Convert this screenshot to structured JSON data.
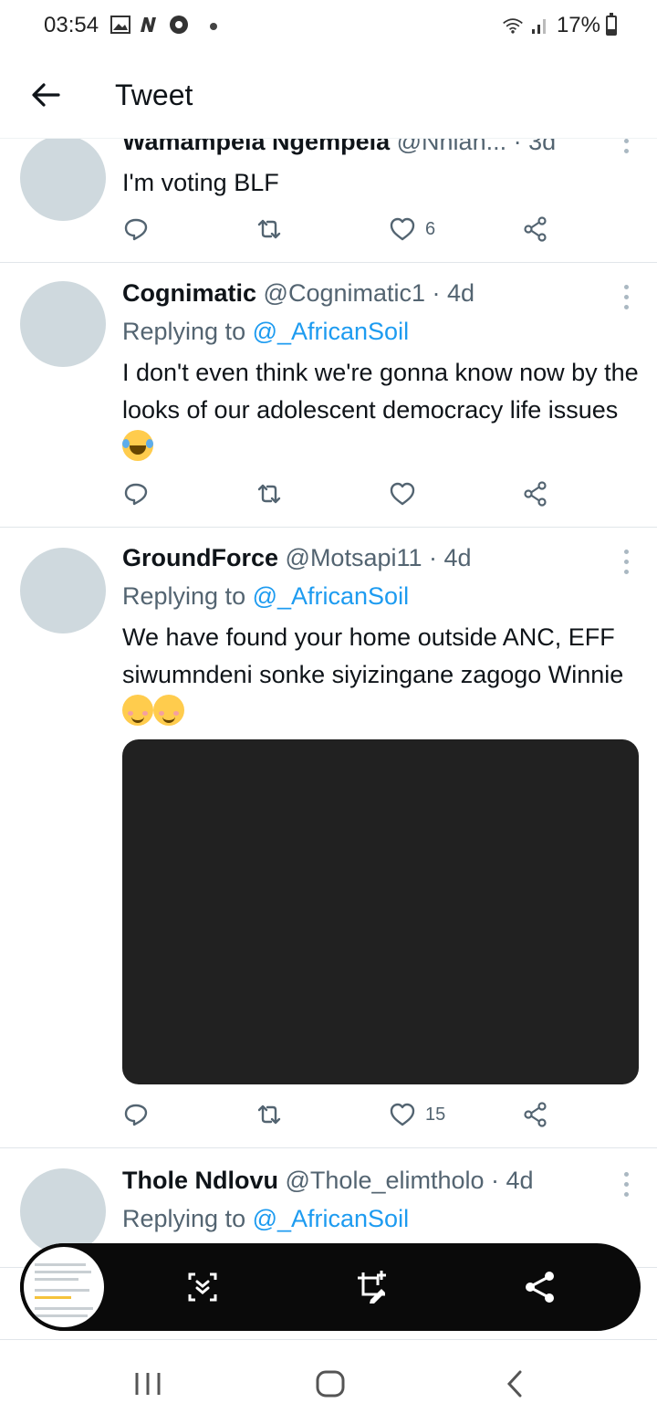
{
  "status_bar": {
    "time": "03:54",
    "battery": "17%"
  },
  "header": {
    "title": "Tweet"
  },
  "tweets": [
    {
      "name": "Wamampela Ngempela",
      "handle": "@Nhlan...",
      "time": " · 3d",
      "replying_to_label": "",
      "mention": "",
      "text": "I'm voting BLF",
      "likes": "6"
    },
    {
      "name": "Cognimatic",
      "handle": "@Cognimatic1",
      "time": " · 4d",
      "replying_to_label": "Replying to ",
      "mention": "@_AfricanSoil",
      "text": "I don't even think we're gonna know now by the looks of our adolescent democracy life issues",
      "likes": ""
    },
    {
      "name": "GroundForce",
      "handle": "@Motsapi11",
      "time": " · 4d",
      "replying_to_label": "Replying to ",
      "mention": "@_AfricanSoil",
      "text": "We have found your home outside ANC, EFF siwumndeni sonke siyizingane zagogo Winnie ",
      "likes": "15"
    },
    {
      "name": "Thole Ndlovu",
      "handle": "@Thole_elimtholo",
      "time": " · 4d",
      "replying_to_label": "Replying to ",
      "mention": "@_AfricanSoil",
      "text": "",
      "likes": ""
    }
  ],
  "icons": {
    "reply": "reply-icon",
    "retweet": "retweet-icon",
    "like": "heart-icon",
    "share": "share-icon",
    "more": "more-icon"
  },
  "colors": {
    "link": "#1d9bf0",
    "secondary_text": "#536471",
    "avatar_placeholder": "#cfd9de",
    "toolbar": "#0a0a0a"
  }
}
